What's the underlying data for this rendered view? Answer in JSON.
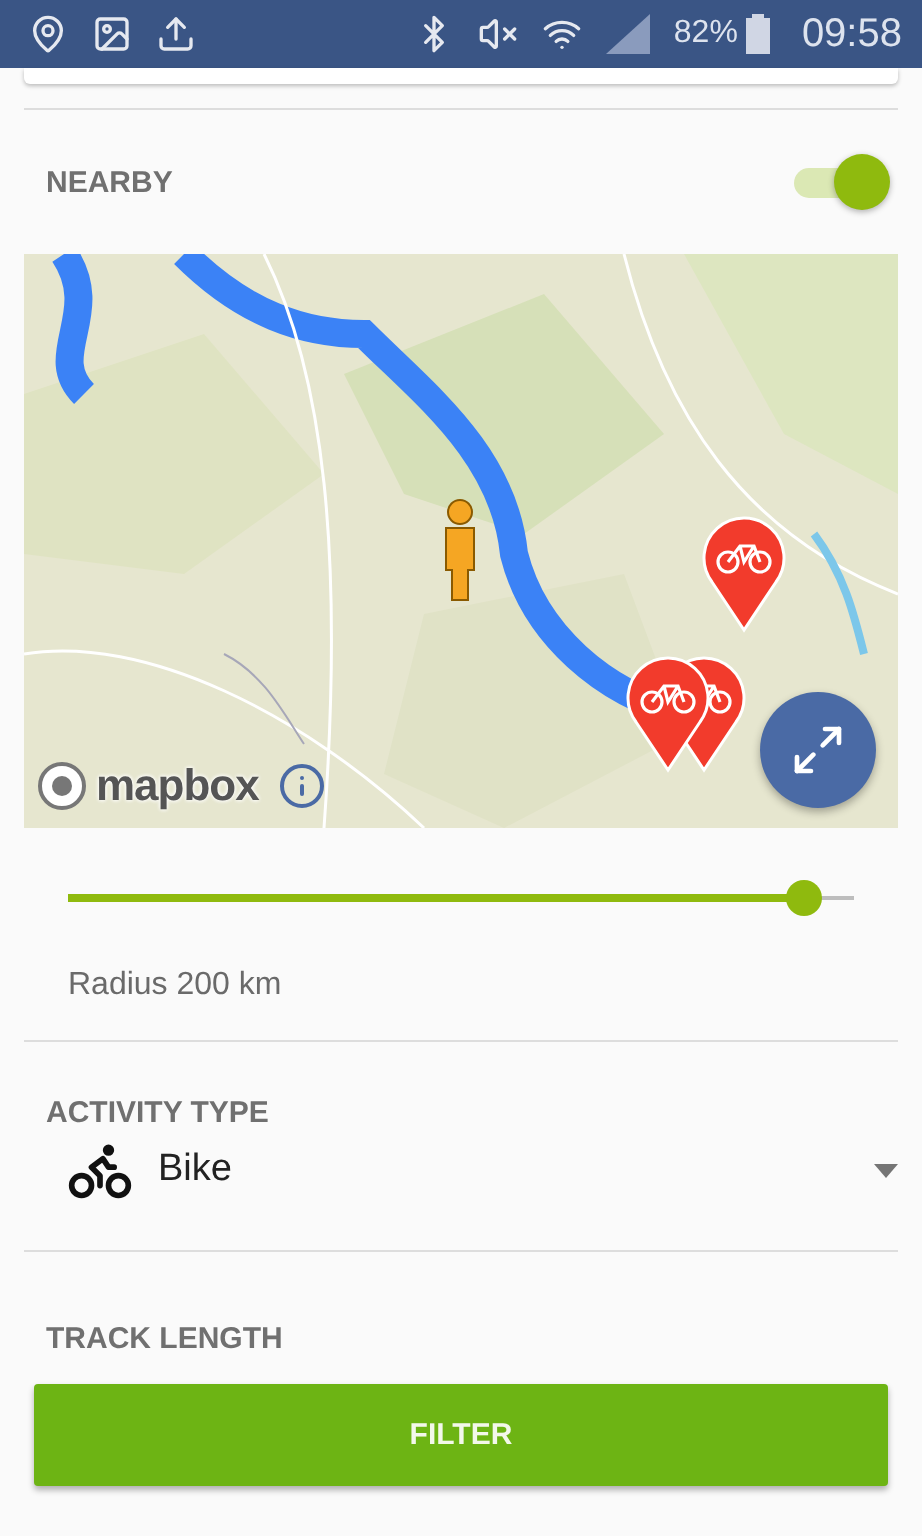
{
  "status_bar": {
    "battery": "82%",
    "time": "09:58"
  },
  "nearby": {
    "title": "NEARBY",
    "on": true,
    "map": {
      "kind": "picture",
      "attribution": "mapbox"
    },
    "radius": {
      "level": 0.936,
      "label": "Radius 200 km"
    }
  },
  "activity_type": {
    "title": "ACTIVITY TYPE",
    "value": "Bike"
  },
  "track_length": {
    "title": "TRACK LENGTH"
  },
  "button": "FILTER"
}
